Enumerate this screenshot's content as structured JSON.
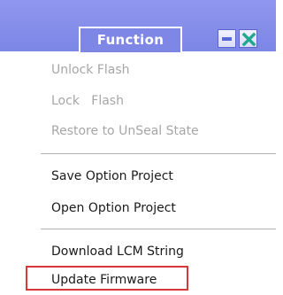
{
  "header": {
    "function_label": "Function",
    "minimize_icon": "minimize-icon",
    "close_icon": "close-icon",
    "colors": {
      "titlebar": "#8089e8",
      "minimize_bar": "#5966da",
      "close_x": "#1fa88e",
      "highlight_border": "#d9383a"
    }
  },
  "menu": {
    "group1": [
      {
        "label": "Unlock Flash",
        "enabled": false
      },
      {
        "label": "Lock   Flash",
        "enabled": false
      },
      {
        "label": "Restore to UnSeal State",
        "enabled": false
      }
    ],
    "group2": [
      {
        "label": "Save Option Project",
        "enabled": true
      },
      {
        "label": "Open Option Project",
        "enabled": true
      }
    ],
    "group3": [
      {
        "label": "Download LCM String",
        "enabled": true
      },
      {
        "label": "Update Firmware",
        "enabled": true,
        "highlighted": true
      }
    ]
  }
}
